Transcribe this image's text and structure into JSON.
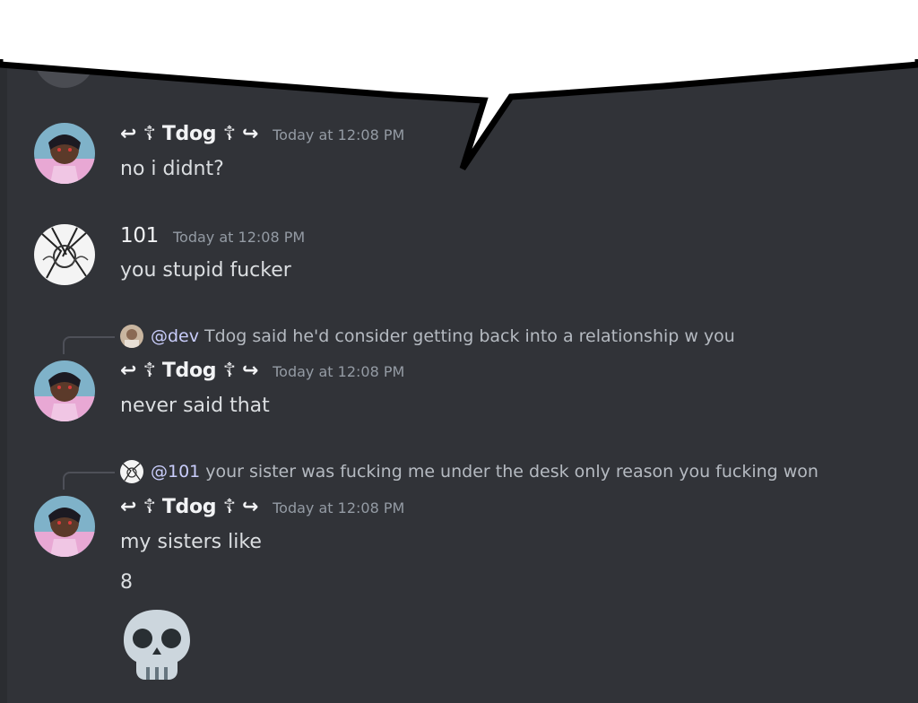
{
  "messages": [
    {
      "author": "↩ ☦ Tdog ☦ ↪",
      "timestamp": "Today at 12:08 PM",
      "lines": [
        "no i didnt?"
      ]
    },
    {
      "author": "101",
      "timestamp": "Today at 12:08 PM",
      "lines": [
        "you stupid fucker"
      ]
    },
    {
      "reply": {
        "mention": "@dev",
        "text": "Tdog said he'd consider getting back into a relationship w you"
      },
      "author": "↩ ☦ Tdog ☦ ↪",
      "timestamp": "Today at 12:08 PM",
      "lines": [
        "never said that"
      ]
    },
    {
      "reply": {
        "mention": "@101",
        "text": "your sister was fucking me under the desk only reason you fucking won"
      },
      "author": "↩ ☦ Tdog ☦ ↪",
      "timestamp": "Today at 12:08 PM",
      "lines": [
        "my sisters like",
        "8"
      ],
      "emoji": "skull-emoji"
    }
  ],
  "colors": {
    "background": "#313338",
    "username": "#f2f3f5",
    "timestamp": "#949ba4",
    "message_text": "#dbdee1",
    "mention": "#c9cdfb",
    "speech_bubble": "#ffffff"
  }
}
